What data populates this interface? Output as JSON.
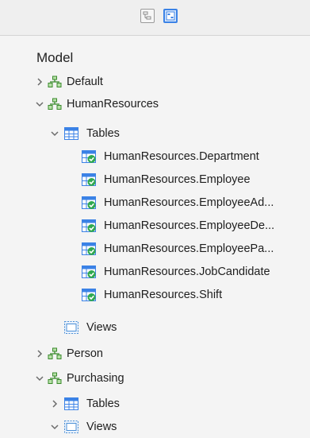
{
  "colors": {
    "schema_icon": "#3a8a2c",
    "table_icon": "#3b82e6",
    "check": "#2fa84f",
    "views_icon": "#4b8fd6"
  },
  "toolbar": {
    "buttons": [
      {
        "icon": "file-tree-icon",
        "active": false
      },
      {
        "icon": "database-model-icon",
        "active": true
      }
    ]
  },
  "tree": {
    "heading": "Model",
    "items": [
      {
        "label": "Default",
        "icon": "schema-icon",
        "expanded": false
      },
      {
        "label": "HumanResources",
        "icon": "schema-icon",
        "expanded": true
      },
      {
        "label": "Tables",
        "icon": "tables-folder-icon",
        "expanded": true
      },
      {
        "label": "HumanResources.Department",
        "icon": "table-check-icon"
      },
      {
        "label": "HumanResources.Employee",
        "icon": "table-check-icon"
      },
      {
        "label": "HumanResources.EmployeeAd...",
        "icon": "table-check-icon"
      },
      {
        "label": "HumanResources.EmployeeDe...",
        "icon": "table-check-icon"
      },
      {
        "label": "HumanResources.EmployeePa...",
        "icon": "table-check-icon"
      },
      {
        "label": "HumanResources.JobCandidate",
        "icon": "table-check-icon"
      },
      {
        "label": "HumanResources.Shift",
        "icon": "table-check-icon"
      },
      {
        "label": "Views",
        "icon": "views-folder-icon"
      },
      {
        "label": "Person",
        "icon": "schema-icon",
        "expanded": false
      },
      {
        "label": "Purchasing",
        "icon": "schema-icon",
        "expanded": true
      },
      {
        "label": "Tables",
        "icon": "tables-folder-icon",
        "expanded": false
      },
      {
        "label": "Views",
        "icon": "views-folder-icon",
        "expanded": true
      }
    ]
  }
}
